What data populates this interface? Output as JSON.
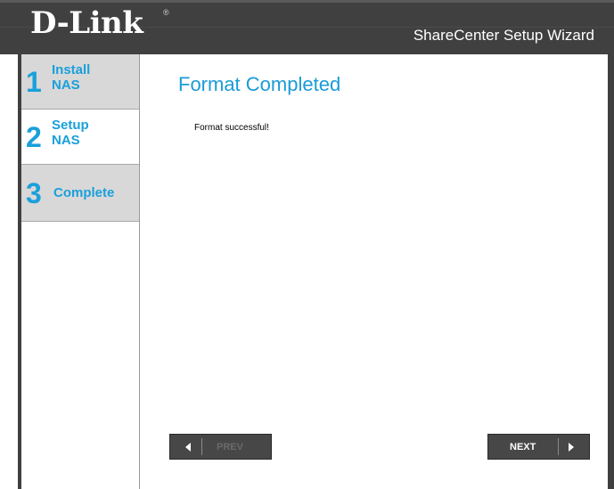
{
  "header": {
    "logo_text": "D-Link",
    "logo_mark": "®",
    "wizard_title": "ShareCenter Setup Wizard"
  },
  "sidebar": {
    "steps": [
      {
        "number": "1",
        "line1": "Install",
        "line2": "NAS",
        "state": "inactive"
      },
      {
        "number": "2",
        "line1": "Setup",
        "line2": "NAS",
        "state": "active"
      },
      {
        "number": "3",
        "label": "Complete",
        "state": "inactive"
      }
    ]
  },
  "main": {
    "title": "Format Completed",
    "message": "Format successful!"
  },
  "buttons": {
    "prev_label": "PREV",
    "next_label": "NEXT",
    "prev_enabled": false,
    "next_enabled": true
  },
  "colors": {
    "accent": "#1aa0db",
    "header_bg": "#404040",
    "inactive_step_bg": "#d8d8d8"
  },
  "icons": {
    "prev": "arrow-left-icon",
    "next": "arrow-right-icon"
  }
}
